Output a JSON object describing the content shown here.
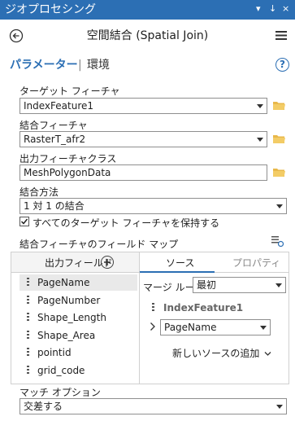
{
  "window": {
    "title": "ジオプロセシング",
    "controls": [
      "▾",
      "↓",
      "×"
    ]
  },
  "tool": {
    "title": "空間結合 (Spatial Join)"
  },
  "tabs": {
    "parameters": "パラメーター",
    "separator": "|",
    "environments": "環境",
    "help_label": "?"
  },
  "params": {
    "target_label": "ターゲット フィーチャ",
    "target_value": "IndexFeature1",
    "join_label": "結合フィーチャ",
    "join_value": "RasterT_afr2",
    "output_label": "出力フィーチャクラス",
    "output_value": "MeshPolygonData",
    "join_op_label": "結合方法",
    "join_op_value": "1 対 1 の結合",
    "keep_all_label": "すべてのターゲット フィーチャを保持する",
    "keep_all_checked": true,
    "field_map_label": "結合フィーチャのフィールド マップ",
    "match_label": "マッチ オプション",
    "match_value": "交差する"
  },
  "field_map": {
    "output_fields_header": "出力フィールド",
    "source_tab": "ソース",
    "properties_tab": "プロパティ",
    "fields": [
      "PageName",
      "PageNumber",
      "Shape_Length",
      "Shape_Area",
      "pointid",
      "grid_code"
    ],
    "selected_index": 0,
    "merge_rule_label": "マージ ルール",
    "merge_rule_value": "最初",
    "source_layer": "IndexFeature1",
    "source_field": "PageName",
    "add_source_label": "新しいソースの追加"
  },
  "colors": {
    "titlebar": "#2c6fb4",
    "accent": "#2c6fb4",
    "folder": "#e8b84a",
    "selected_row": "#e9e9e9"
  }
}
